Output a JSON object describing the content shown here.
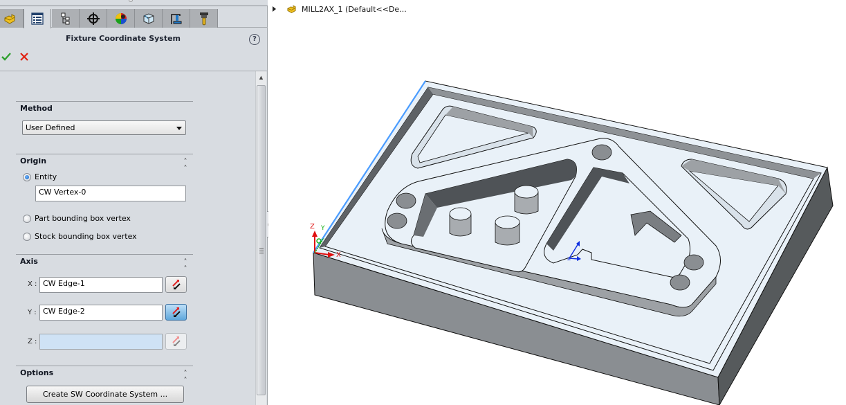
{
  "property_manager": {
    "tabs": [
      {
        "name": "part-icon",
        "active": false
      },
      {
        "name": "property-manager-icon",
        "active": true
      },
      {
        "name": "configuration-tree-icon",
        "active": false
      },
      {
        "name": "target-icon",
        "active": false
      },
      {
        "name": "appearance-icon",
        "active": false
      },
      {
        "name": "stock-box-icon",
        "active": false
      },
      {
        "name": "machine-icon",
        "active": false
      },
      {
        "name": "tool-icon",
        "active": false
      }
    ],
    "title": "Fixture Coordinate System",
    "help_label": "?",
    "ok_label": "OK",
    "cancel_label": "Cancel",
    "method": {
      "title": "Method",
      "selected": "User Defined"
    },
    "origin": {
      "title": "Origin",
      "options": [
        {
          "label": "Entity",
          "checked": true
        },
        {
          "label": "Part bounding box vertex",
          "checked": false
        },
        {
          "label": "Stock bounding box vertex",
          "checked": false
        }
      ],
      "entity_value": "CW Vertex-0"
    },
    "axis": {
      "title": "Axis",
      "x_label": "X :",
      "x_value": "CW Edge-1",
      "y_label": "Y :",
      "y_value": "CW Edge-2",
      "z_label": "Z :",
      "z_value": ""
    },
    "options": {
      "title": "Options",
      "create_button": "Create SW Coordinate System ..."
    },
    "collapse_glyph": "˄"
  },
  "graphics": {
    "tree_node": "MILL2AX_1  (Default<<De...",
    "triad": {
      "x": "X",
      "y": "Y",
      "z": "Z"
    },
    "colors": {
      "top_face": "#e9f1f8",
      "front_face": "#8a8e92",
      "side_face": "#565a5c",
      "wall": "#a3a7ab",
      "highlight_edge": "#4a9cff",
      "axis_x": "#e01010",
      "axis_y": "#18b018",
      "axis_z": "#e01010",
      "origin_marker": "#1030e0"
    }
  }
}
